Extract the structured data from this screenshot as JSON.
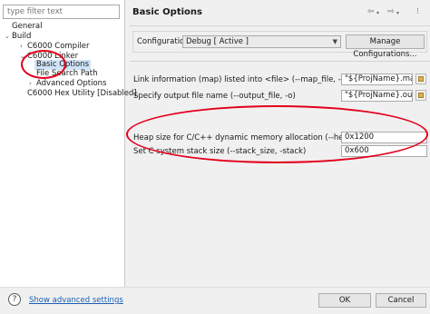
{
  "filter": {
    "placeholder": "type filter text"
  },
  "tree": {
    "general": "General",
    "build": "Build",
    "c6000_compiler": "C6000 Compiler",
    "c6000_linker": "C6000 Linker",
    "basic_options": "Basic Options",
    "file_search_path": "File Search Path",
    "advanced_options": "Advanced Options",
    "hex_utility": "C6000 Hex Utility  [Disabled]"
  },
  "page_title": "Basic Options",
  "configuration": {
    "label": "Configuration:",
    "value": "Debug  [ Active ]",
    "manage_button": "Manage Configurations..."
  },
  "options": [
    {
      "label": "Link information (map) listed into <file> (--map_file, -m)",
      "value": "\"${ProjName}.map\""
    },
    {
      "label": "Specify output file name (--output_file, -o)",
      "value": "\"${ProjName}.out\""
    },
    {
      "label": "Heap size for C/C++ dynamic memory allocation (--heap_size, -heap)",
      "value": "0x1200"
    },
    {
      "label": "Set C system stack size (--stack_size, -stack)",
      "value": "0x600"
    }
  ],
  "footer": {
    "advanced_link": "Show advanced settings",
    "ok": "OK",
    "cancel": "Cancel"
  },
  "icons": {
    "nav_back": "back-arrow-icon",
    "nav_forward": "forward-arrow-icon",
    "menu": "view-menu-icon",
    "help": "help-icon",
    "browse": "browse-file-icon"
  },
  "colors": {
    "annotation": "#e3001b",
    "link": "#1a5fb4",
    "selection": "#cfe3f7"
  }
}
